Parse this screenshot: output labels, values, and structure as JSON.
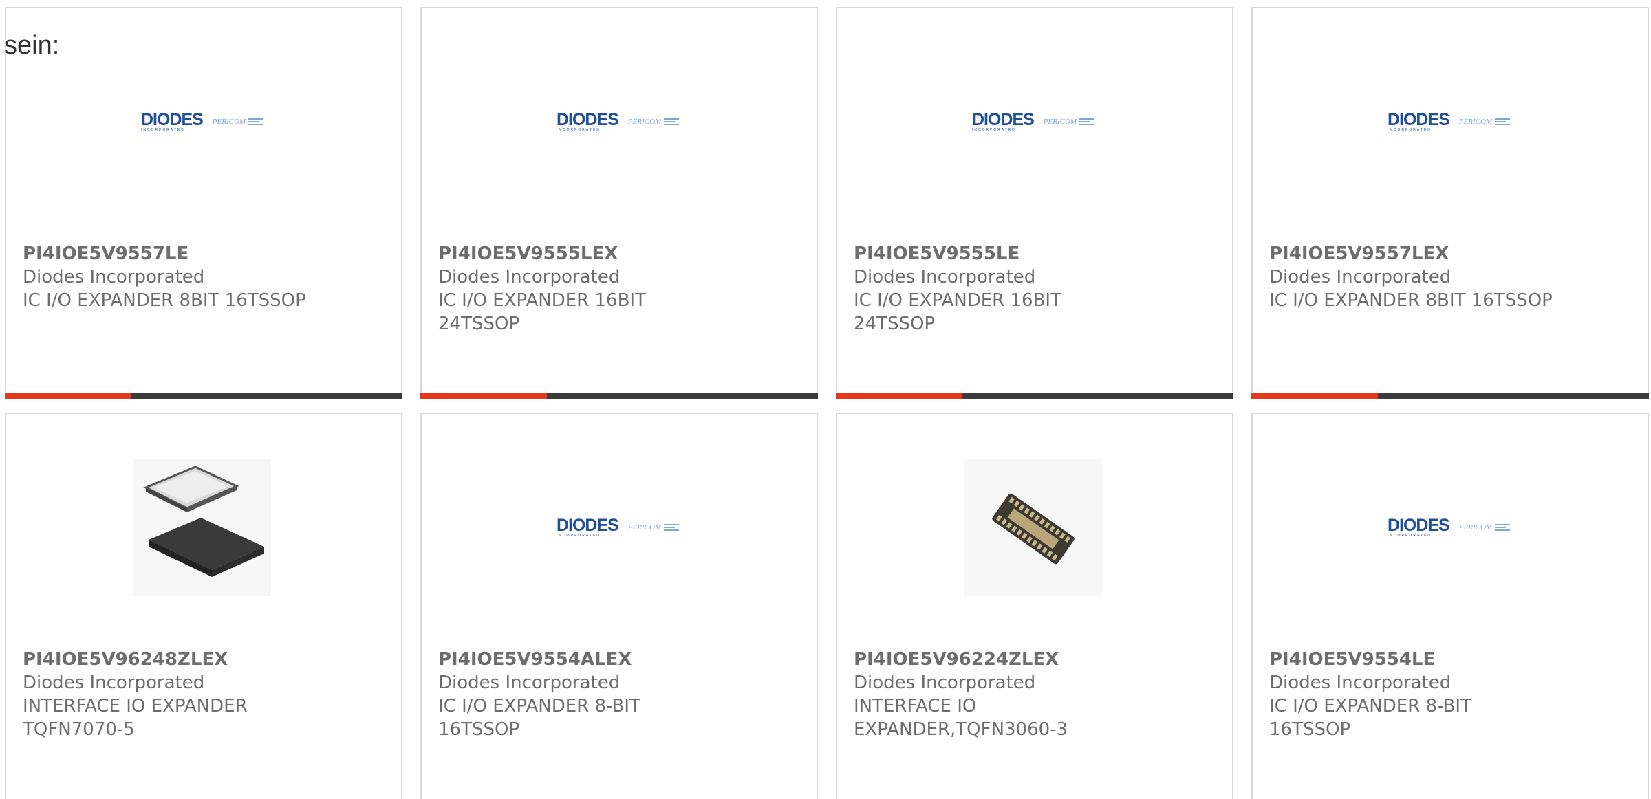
{
  "intro": {
    "text": "sein:"
  },
  "colors": {
    "accent": "#e3381a",
    "bar_dark": "#3b3b3b",
    "border": "#d8d8d8",
    "text": "#6d6d6d",
    "logo_blue": "#1f4e9a",
    "logo_light_blue": "#7fa6d6"
  },
  "logo": {
    "diodes": "DIODES",
    "diodes_sub": "INCORPORATED",
    "pericom": "PERICOM"
  },
  "products": [
    {
      "part": "PI4IOE5V9557LE",
      "maker": "Diodes Incorporated",
      "desc": [
        "IC I/O EXPANDER 8BIT 16TSSOP"
      ],
      "image": "diodes-pericom-logo",
      "accent_bar": true
    },
    {
      "part": "PI4IOE5V9555LEX",
      "maker": "Diodes Incorporated",
      "desc": [
        "IC I/O EXPANDER 16BIT",
        "24TSSOP"
      ],
      "image": "diodes-pericom-logo",
      "accent_bar": true
    },
    {
      "part": "PI4IOE5V9555LE",
      "maker": "Diodes Incorporated",
      "desc": [
        "IC I/O EXPANDER 16BIT",
        "24TSSOP"
      ],
      "image": "diodes-pericom-logo",
      "accent_bar": true
    },
    {
      "part": "PI4IOE5V9557LEX",
      "maker": "Diodes Incorporated",
      "desc": [
        "IC I/O EXPANDER 8BIT 16TSSOP"
      ],
      "image": "diodes-pericom-logo",
      "accent_bar": true
    },
    {
      "part": "PI4IOE5V96248ZLEX",
      "maker": "Diodes Incorporated",
      "desc": [
        "INTERFACE IO EXPANDER",
        "TQFN7070-5"
      ],
      "image": "qfn-chip-photo",
      "accent_bar": false
    },
    {
      "part": "PI4IOE5V9554ALEX",
      "maker": "Diodes Incorporated",
      "desc": [
        "IC I/O EXPANDER 8-BIT 16TSSOP"
      ],
      "image": "diodes-pericom-logo",
      "accent_bar": false
    },
    {
      "part": "PI4IOE5V96224ZLEX",
      "maker": "Diodes Incorporated",
      "desc": [
        "INTERFACE IO",
        "EXPANDER,TQFN3060-3"
      ],
      "image": "small-qfn-chip-photo",
      "accent_bar": false
    },
    {
      "part": "PI4IOE5V9554LE",
      "maker": "Diodes Incorporated",
      "desc": [
        "IC I/O EXPANDER 8-BIT 16TSSOP"
      ],
      "image": "diodes-pericom-logo",
      "accent_bar": false
    }
  ]
}
